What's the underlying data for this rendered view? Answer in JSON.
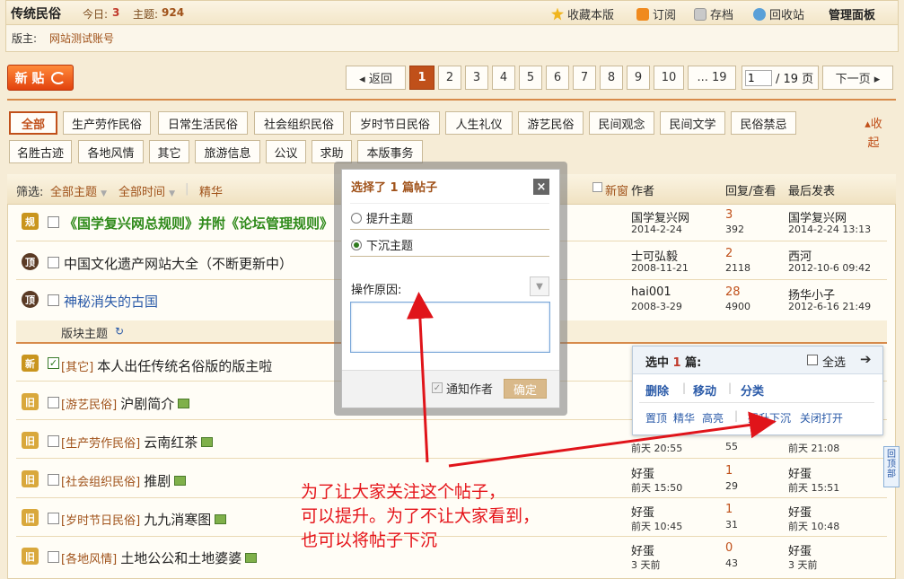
{
  "header": {
    "forum_title": "传统民俗",
    "today_label": "今日:",
    "today_value": "3",
    "topics_label": "主题:",
    "topics_value": "924",
    "links": {
      "favorite": "收藏本版",
      "subscribe": "订阅",
      "archive": "存档",
      "recycle": "回收站"
    },
    "admin_panel": "管理面板",
    "moderator_label": "版主:",
    "moderator_name": "网站测试账号"
  },
  "toolbar": {
    "new_post": "新 贴",
    "back": "◂ 返回",
    "pages": [
      "1",
      "2",
      "3",
      "4",
      "5",
      "6",
      "7",
      "8",
      "9",
      "10",
      "... 19"
    ],
    "current_page": "1",
    "page_total": "/ 19 页",
    "next_page": "下一页 ▸"
  },
  "categories": {
    "row1": [
      "全部",
      "生产劳作民俗",
      "日常生活民俗",
      "社会组织民俗",
      "岁时节日民俗",
      "人生礼仪",
      "游艺民俗",
      "民间观念",
      "民间文学",
      "民俗禁忌"
    ],
    "row2": [
      "名胜古迹",
      "各地风情",
      "其它",
      "旅游信息",
      "公议",
      "求助",
      "本版事务"
    ],
    "collapse": "收起"
  },
  "filter": {
    "label": "筛选:",
    "all_topics": "全部主题",
    "all_time": "全部时间",
    "digest": "精华",
    "new_window": "新窗",
    "col_author": "作者",
    "col_reply_view": "回复/查看",
    "col_last_post": "最后发表"
  },
  "threads": [
    {
      "icon": "规",
      "tag": "",
      "title": "《国学复兴网总规则》并附《论坛管理规则》",
      "author": "国学复兴网",
      "date": "2014-2-24",
      "replies": "3",
      "views": "392",
      "last_user": "国学复兴网",
      "last_time": "2014-2-24 13:13"
    },
    {
      "icon": "顶",
      "tag": "",
      "title": "中国文化遗产网站大全（不断更新中）",
      "author": "士可弘毅",
      "date": "2008-11-21",
      "replies": "2",
      "views": "2118",
      "last_user": "西河",
      "last_time": "2012-10-6 09:42"
    },
    {
      "icon": "顶",
      "tag": "",
      "title": "神秘消失的古国",
      "author": "hai001",
      "date": "2008-3-29",
      "replies": "28",
      "views": "4900",
      "last_user": "扬华小子",
      "last_time": "2012-6-16 21:49"
    },
    {
      "icon": "新",
      "tag": "[其它]",
      "title": "本人出任传统名俗版的版主啦",
      "author": "",
      "date": "",
      "replies": "",
      "views": "",
      "last_user": "",
      "last_time": ""
    },
    {
      "icon": "旧",
      "tag": "[游艺民俗]",
      "title": "沪剧简介",
      "author": "",
      "date": "",
      "replies": "",
      "views": "",
      "last_user": "",
      "last_time": ""
    },
    {
      "icon": "旧",
      "tag": "[生产劳作民俗]",
      "title": "云南红茶",
      "author": "",
      "date": "前天 20:55",
      "replies": "",
      "views": "55",
      "last_user": "",
      "last_time": "前天 21:08"
    },
    {
      "icon": "旧",
      "tag": "[社会组织民俗]",
      "title": "推剧",
      "author": "好蛋",
      "date": "前天 15:50",
      "replies": "1",
      "views": "29",
      "last_user": "好蛋",
      "last_time": "前天 15:51"
    },
    {
      "icon": "旧",
      "tag": "[岁时节日民俗]",
      "title": "九九消寒图",
      "author": "好蛋",
      "date": "前天 10:45",
      "replies": "1",
      "views": "31",
      "last_user": "好蛋",
      "last_time": "前天 10:48"
    },
    {
      "icon": "旧",
      "tag": "[各地风情]",
      "title": "土地公公和土地婆婆",
      "author": "好蛋",
      "date": "3 天前",
      "replies": "0",
      "views": "43",
      "last_user": "好蛋",
      "last_time": "3 天前"
    }
  ],
  "section": {
    "label": "版块主题",
    "refresh_icon": "refresh-icon"
  },
  "modal": {
    "title": "选择了 1 篇帖子",
    "option_raise": "提升主题",
    "option_sink": "下沉主题",
    "reason_label": "操作原因:",
    "notify_label": "通知作者",
    "confirm": "确定"
  },
  "selection": {
    "title_prefix": "选中",
    "count": "1",
    "title_suffix": "篇:",
    "select_all": "全选",
    "actions": [
      "删除",
      "移动",
      "分类"
    ],
    "sub_actions": [
      "置顶",
      "精华",
      "高亮",
      "提升下沉",
      "关闭打开"
    ]
  },
  "back_to_top": "回顶部",
  "annotation": {
    "line1": "为了让大家关注这个帖子，",
    "line2": "可以提升。为了不让大家看到，",
    "line3": "也可以将帖子下沉"
  },
  "colors": {
    "accent": "#c0501a",
    "link": "#2a5aa8",
    "annotation": "#e5141a"
  }
}
